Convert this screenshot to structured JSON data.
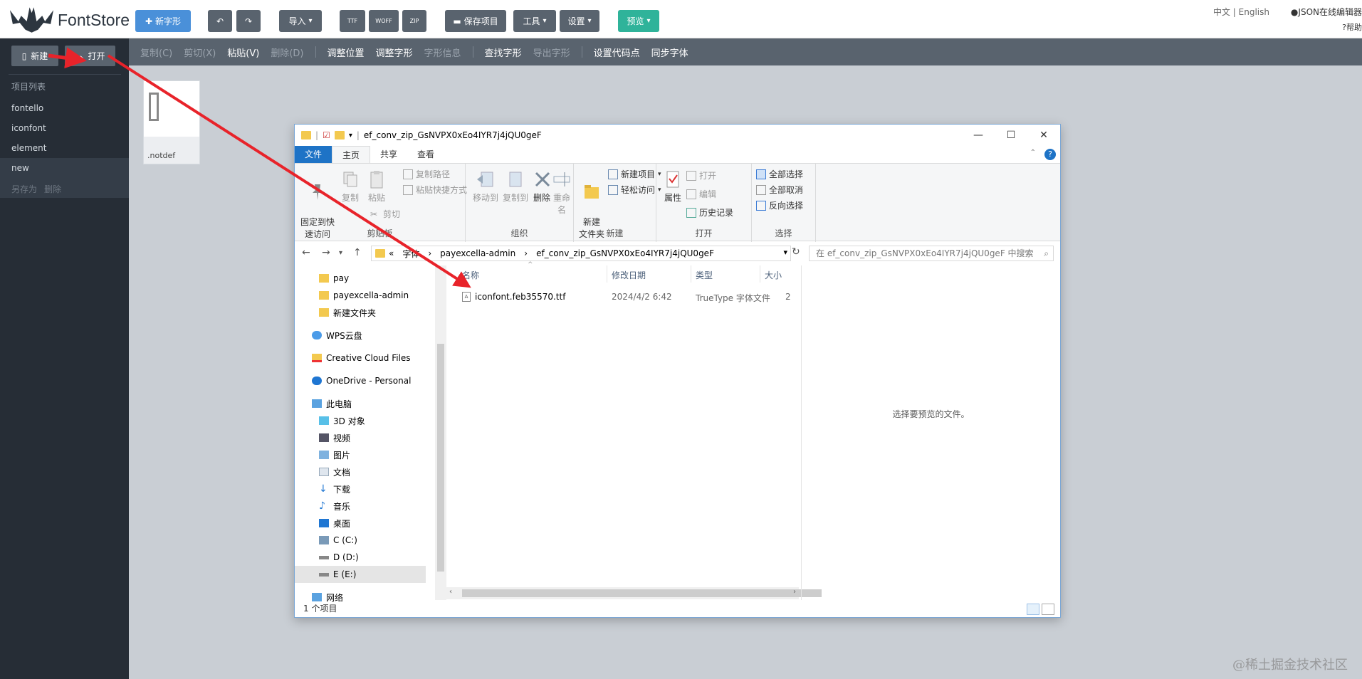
{
  "header": {
    "logo_text": "FontStore",
    "new_glyph": "新字形",
    "import": "导入",
    "ttf": "TTF",
    "woff": "WOFF",
    "zip": "ZIP",
    "save_project": "保存项目",
    "tools": "工具",
    "settings": "设置",
    "preview": "预览",
    "lang": "中文 | English",
    "json_editor": "JSON在线编辑器",
    "help": "帮助"
  },
  "sidebar": {
    "new_btn": "新建",
    "open_btn": "打开",
    "section_title": "项目列表",
    "items": [
      "fontello",
      "iconfont",
      "element",
      "new"
    ],
    "save_as": "另存为",
    "delete": "删除"
  },
  "toolbar2": {
    "copy": "复制(C)",
    "cut": "剪切(X)",
    "paste": "粘贴(V)",
    "delete": "删除(D)",
    "adjust_pos": "调整位置",
    "adjust_glyph": "调整字形",
    "glyph_info": "字形信息",
    "find_glyph": "查找字形",
    "export_glyph": "导出字形",
    "set_codepoint": "设置代码点",
    "sync_font": "同步字体"
  },
  "glyph": {
    "name": ".notdef"
  },
  "explorer": {
    "title": "ef_conv_zip_GsNVPX0xEo4IYR7j4jQU0geF",
    "tabs": [
      "文件",
      "主页",
      "共享",
      "查看"
    ],
    "ribbon": {
      "pin": "固定到快\n速访问",
      "copy": "复制",
      "paste": "粘贴",
      "copy_path": "复制路径",
      "paste_shortcut": "粘贴快捷方式",
      "cut": "剪切",
      "clipboard": "剪贴板",
      "move_to": "移动到",
      "copy_to": "复制到",
      "delete": "删除",
      "rename": "重命名",
      "organize": "组织",
      "new_folder": "新建\n文件夹",
      "new_item": "新建项目",
      "easy_access": "轻松访问",
      "new": "新建",
      "properties": "属性",
      "open": "打开",
      "edit": "编辑",
      "history": "历史记录",
      "open_group": "打开",
      "select_all": "全部选择",
      "select_none": "全部取消",
      "invert": "反向选择",
      "select_group": "选择"
    },
    "address": [
      "«",
      "字体",
      "payexcella-admin",
      "ef_conv_zip_GsNVPX0xEo4IYR7j4jQU0geF"
    ],
    "search_placeholder": "在 ef_conv_zip_GsNVPX0xEo4IYR7j4jQU0geF 中搜索",
    "tree": [
      "pay",
      "payexcella-admin",
      "新建文件夹",
      "WPS云盘",
      "Creative Cloud Files",
      "OneDrive - Personal",
      "此电脑",
      "3D 对象",
      "视频",
      "图片",
      "文档",
      "下载",
      "音乐",
      "桌面",
      "C (C:)",
      "D (D:)",
      "E (E:)",
      "网络"
    ],
    "columns": [
      "名称",
      "修改日期",
      "类型",
      "大小"
    ],
    "file": {
      "name": "iconfont.feb35570.ttf",
      "date": "2024/4/2 6:42",
      "type": "TrueType 字体文件",
      "size": "2"
    },
    "preview_hint": "选择要预览的文件。",
    "status": "1 个项目"
  },
  "watermark": "@稀土掘金技术社区"
}
